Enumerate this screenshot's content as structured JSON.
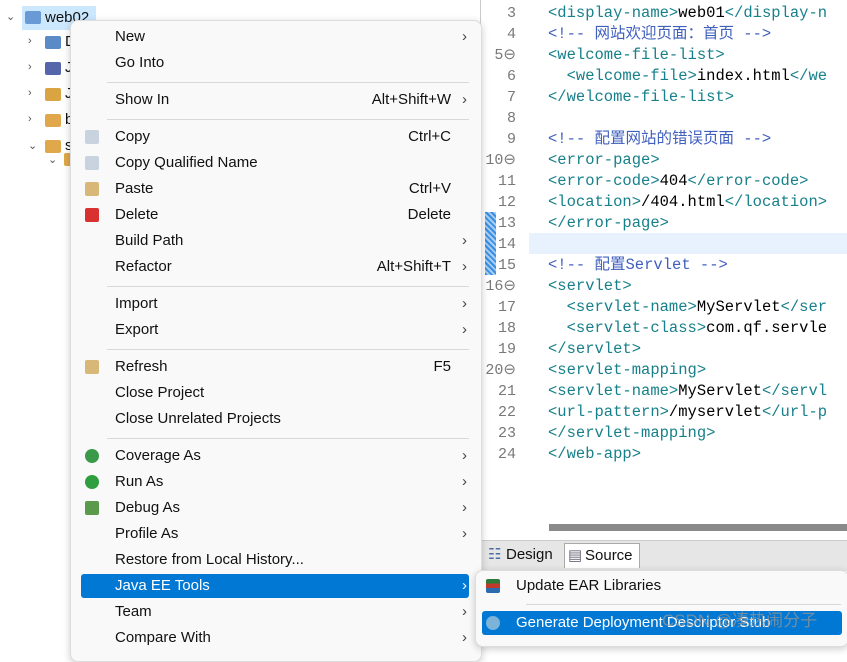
{
  "tree": {
    "project": "web02",
    "children": [
      "D",
      "J",
      "J",
      "b",
      "s"
    ]
  },
  "editor": {
    "lines": [
      {
        "n": "3",
        "parts": [
          [
            "tag",
            "<display-name>"
          ],
          [
            "t",
            "web01"
          ],
          [
            "tag",
            "</display-n"
          ]
        ]
      },
      {
        "n": "4",
        "parts": [
          [
            "cmt",
            "<!-- 网站欢迎页面：首页 -->"
          ]
        ]
      },
      {
        "n": "5⊖",
        "parts": [
          [
            "tag",
            "<welcome-file-list>"
          ]
        ]
      },
      {
        "n": "6",
        "parts": [
          [
            "t",
            "  "
          ],
          [
            "tag",
            "<welcome-file>"
          ],
          [
            "t",
            "index.html"
          ],
          [
            "tag",
            "</we"
          ]
        ]
      },
      {
        "n": "7",
        "parts": [
          [
            "tag",
            "</welcome-file-list>"
          ]
        ]
      },
      {
        "n": "8",
        "parts": []
      },
      {
        "n": "9",
        "parts": [
          [
            "cmt",
            "<!-- 配置网站的错误页面 -->"
          ]
        ]
      },
      {
        "n": "10⊖",
        "parts": [
          [
            "tag",
            "<error-page>"
          ]
        ]
      },
      {
        "n": "11",
        "parts": [
          [
            "tag",
            "<error-code>"
          ],
          [
            "t",
            "404"
          ],
          [
            "tag",
            "</error-code>"
          ]
        ]
      },
      {
        "n": "12",
        "parts": [
          [
            "tag",
            "<location>"
          ],
          [
            "t",
            "/404.html"
          ],
          [
            "tag",
            "</location>"
          ]
        ]
      },
      {
        "n": "13",
        "parts": [
          [
            "tag",
            "</error-page>"
          ]
        ]
      },
      {
        "n": "14",
        "parts": []
      },
      {
        "n": "15",
        "parts": [
          [
            "cmt",
            "<!-- 配置Servlet -->"
          ]
        ]
      },
      {
        "n": "16⊖",
        "parts": [
          [
            "tag",
            "<servlet>"
          ]
        ]
      },
      {
        "n": "17",
        "parts": [
          [
            "t",
            "  "
          ],
          [
            "tag",
            "<servlet-name>"
          ],
          [
            "t",
            "MyServlet"
          ],
          [
            "tag",
            "</ser"
          ]
        ]
      },
      {
        "n": "18",
        "parts": [
          [
            "t",
            "  "
          ],
          [
            "tag",
            "<servlet-class>"
          ],
          [
            "t",
            "com.qf.servle"
          ]
        ]
      },
      {
        "n": "19",
        "parts": [
          [
            "tag",
            "</servlet>"
          ]
        ]
      },
      {
        "n": "20⊖",
        "parts": [
          [
            "tag",
            "<servlet-mapping>"
          ]
        ]
      },
      {
        "n": "21",
        "parts": [
          [
            "tag",
            "<servlet-name>"
          ],
          [
            "t",
            "MyServlet"
          ],
          [
            "tag",
            "</servl"
          ]
        ]
      },
      {
        "n": "22",
        "parts": [
          [
            "tag",
            "<url-pattern>"
          ],
          [
            "t",
            "/myservlet"
          ],
          [
            "tag",
            "</url-p"
          ]
        ]
      },
      {
        "n": "23",
        "parts": [
          [
            "tag",
            "</servlet-mapping>"
          ]
        ]
      },
      {
        "n": "24",
        "parts": [
          [
            "tag",
            "</web-app>"
          ]
        ]
      }
    ],
    "tabs": [
      "Design",
      "Source"
    ]
  },
  "menu": {
    "items": [
      {
        "label": "New",
        "shortcut": "",
        "submenu": true,
        "icon": ""
      },
      {
        "label": "Go Into",
        "shortcut": "",
        "submenu": false,
        "icon": ""
      },
      {
        "sep": true
      },
      {
        "label": "Show In",
        "shortcut": "Alt+Shift+W",
        "submenu": true,
        "icon": ""
      },
      {
        "sep": true
      },
      {
        "label": "Copy",
        "shortcut": "Ctrl+C",
        "submenu": false,
        "icon": "copy-icon"
      },
      {
        "label": "Copy Qualified Name",
        "shortcut": "",
        "submenu": false,
        "icon": "copy-qualified-icon"
      },
      {
        "label": "Paste",
        "shortcut": "Ctrl+V",
        "submenu": false,
        "icon": "paste-icon"
      },
      {
        "label": "Delete",
        "shortcut": "Delete",
        "submenu": false,
        "icon": "delete-icon"
      },
      {
        "label": "Build Path",
        "shortcut": "",
        "submenu": true,
        "icon": ""
      },
      {
        "label": "Refactor",
        "shortcut": "Alt+Shift+T",
        "submenu": true,
        "icon": ""
      },
      {
        "sep": true
      },
      {
        "label": "Import",
        "shortcut": "",
        "submenu": true,
        "icon": ""
      },
      {
        "label": "Export",
        "shortcut": "",
        "submenu": true,
        "icon": ""
      },
      {
        "sep": true
      },
      {
        "label": "Refresh",
        "shortcut": "F5",
        "submenu": false,
        "icon": "refresh-icon"
      },
      {
        "label": "Close Project",
        "shortcut": "",
        "submenu": false,
        "icon": ""
      },
      {
        "label": "Close Unrelated Projects",
        "shortcut": "",
        "submenu": false,
        "icon": ""
      },
      {
        "sep": true
      },
      {
        "label": "Coverage As",
        "shortcut": "",
        "submenu": true,
        "icon": "coverage-icon"
      },
      {
        "label": "Run As",
        "shortcut": "",
        "submenu": true,
        "icon": "run-icon"
      },
      {
        "label": "Debug As",
        "shortcut": "",
        "submenu": true,
        "icon": "debug-icon"
      },
      {
        "label": "Profile As",
        "shortcut": "",
        "submenu": true,
        "icon": ""
      },
      {
        "label": "Restore from Local History...",
        "shortcut": "",
        "submenu": false,
        "icon": ""
      },
      {
        "label": "Java EE Tools",
        "shortcut": "",
        "submenu": true,
        "icon": "",
        "highlighted": true
      },
      {
        "label": "Team",
        "shortcut": "",
        "submenu": true,
        "icon": ""
      },
      {
        "label": "Compare With",
        "shortcut": "",
        "submenu": true,
        "icon": ""
      }
    ]
  },
  "submenu": {
    "items": [
      {
        "label": "Update EAR Libraries",
        "icon": "libraries-icon"
      },
      {
        "label": "Generate Deployment Descriptor Stub",
        "icon": "descriptor-icon",
        "highlighted": true
      }
    ]
  },
  "watermark": "CSDN @凑热闹分子",
  "colors": {
    "highlight": "#0078d4",
    "tag": "#17808a",
    "comment": "#3f5fbf"
  }
}
